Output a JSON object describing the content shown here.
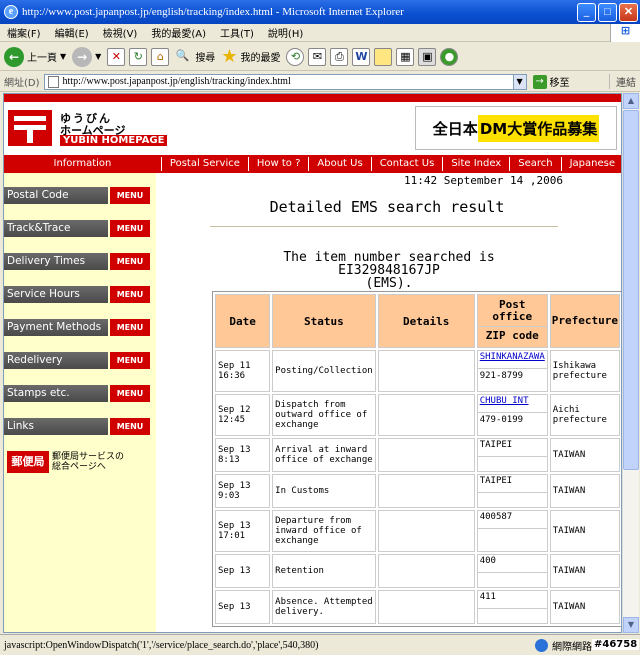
{
  "window": {
    "title": "http://www.post.japanpost.jp/english/tracking/index.html - Microsoft Internet Explorer"
  },
  "menu": [
    "檔案(F)",
    "編輯(E)",
    "檢視(V)",
    "我的最愛(A)",
    "工具(T)",
    "說明(H)"
  ],
  "toolbar": {
    "back": "上一頁",
    "search": "搜尋",
    "favorites": "我的最愛"
  },
  "address": {
    "label": "網址(D)",
    "url": "http://www.post.japanpost.jp/english/tracking/index.html",
    "go": "移至",
    "links": "連結"
  },
  "logo": {
    "jp_line1": "ゆうびん",
    "jp_line2": "ホームページ",
    "en": "YUBIN HOMEPAGE"
  },
  "banner": {
    "text_pre": "全日本",
    "text_hl": "DM大賞作品募集"
  },
  "nav": {
    "info": "Information",
    "items": [
      "Postal Service",
      "How to ?",
      "About Us",
      "Contact Us",
      "Site Index",
      "Search",
      "Japanese"
    ]
  },
  "timestamp": "11:42 September 14 ,2006",
  "sidebar": {
    "menu_label": "MENU",
    "items": [
      "Postal Code",
      "Track&Trace",
      "Delivery Times",
      "Service Hours",
      "Payment Methods",
      "Redelivery",
      "Stamps etc.",
      "Links"
    ],
    "promo": {
      "badge": "郵便局",
      "text1": "郵便局サービスの",
      "text2": "総合ページへ"
    }
  },
  "main": {
    "heading": "Detailed EMS search result",
    "searched_line1": "The item number searched is EI329848167JP",
    "searched_line2": "(EMS)."
  },
  "table": {
    "headers": {
      "date": "Date",
      "status": "Status",
      "details": "Details",
      "post_office": "Post office",
      "zip": "ZIP code",
      "prefecture": "Prefecture"
    },
    "rows": [
      {
        "date": "Sep 11 16:36",
        "status": "Posting/Collection",
        "details": "",
        "office": "SHINKANAZAWA",
        "zip": "921-8799",
        "pref": "Ishikawa prefecture"
      },
      {
        "date": "Sep 12 12:45",
        "status": "Dispatch from outward office of exchange",
        "details": "",
        "office": "CHUBU INT",
        "zip": "479-0199",
        "pref": "Aichi prefecture"
      },
      {
        "date": "Sep 13 8:13",
        "status": "Arrival at inward office of exchange",
        "details": "",
        "office": "TAIPEI",
        "zip": "",
        "pref": "TAIWAN"
      },
      {
        "date": "Sep 13 9:03",
        "status": "In Customs",
        "details": "",
        "office": "TAIPEI",
        "zip": "",
        "pref": "TAIWAN"
      },
      {
        "date": "Sep 13 17:01",
        "status": "Departure from inward office of exchange",
        "details": "",
        "office": "400587",
        "zip": "",
        "pref": "TAIWAN"
      },
      {
        "date": "Sep 13",
        "status": "Retention",
        "details": "",
        "office": "400",
        "zip": "",
        "pref": "TAIWAN"
      },
      {
        "date": "Sep 13",
        "status": "Absence. Attempted delivery.",
        "details": "",
        "office": "411",
        "zip": "",
        "pref": "TAIWAN"
      }
    ]
  },
  "statusbar": {
    "text": "javascript:OpenWindowDispatch('1','/service/place_search.do','place',540,380)",
    "zone": "網際網路"
  },
  "watermark": "#46758"
}
